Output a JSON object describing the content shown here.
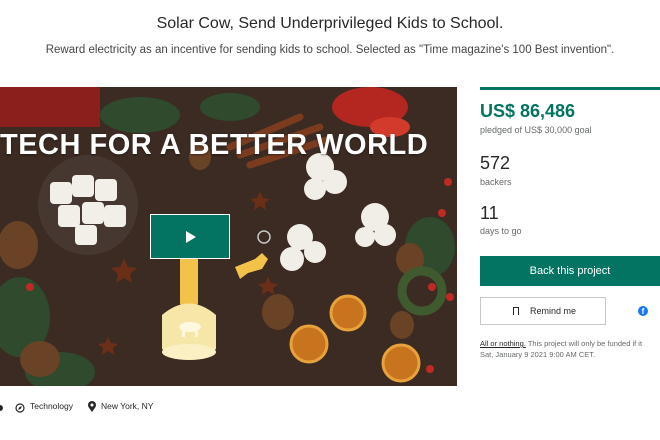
{
  "header": {
    "title": "Solar Cow, Send Underprivileged Kids to School.",
    "subtitle": "Reward electricity as an incentive for sending kids to school. Selected as \"Time magazine's 100 Best invention\"."
  },
  "video": {
    "tagline": "TECH FOR A BETTER WORLD",
    "play_icon": "play-icon"
  },
  "funding": {
    "progress_fraction": 1.0,
    "amount": "US$ 86,486",
    "pledged_label": "pledged of US$ 30,000 goal",
    "backers_count": "572",
    "backers_label": "backers",
    "days_count": "11",
    "days_label": "days to go"
  },
  "actions": {
    "back_label": "Back this project",
    "remind_label": "Remind me",
    "remind_icon": "bookmark-icon",
    "facebook_icon": "facebook-icon"
  },
  "notice": {
    "link_text": "All or nothing.",
    "text": " This project will only be funded if it",
    "date": "Sat, January 9 2021 9:00 AM CET."
  },
  "meta": {
    "category": "Technology",
    "location": "New York, NY"
  },
  "colors": {
    "accent": "#037362",
    "text": "#282828",
    "muted": "#656969"
  }
}
